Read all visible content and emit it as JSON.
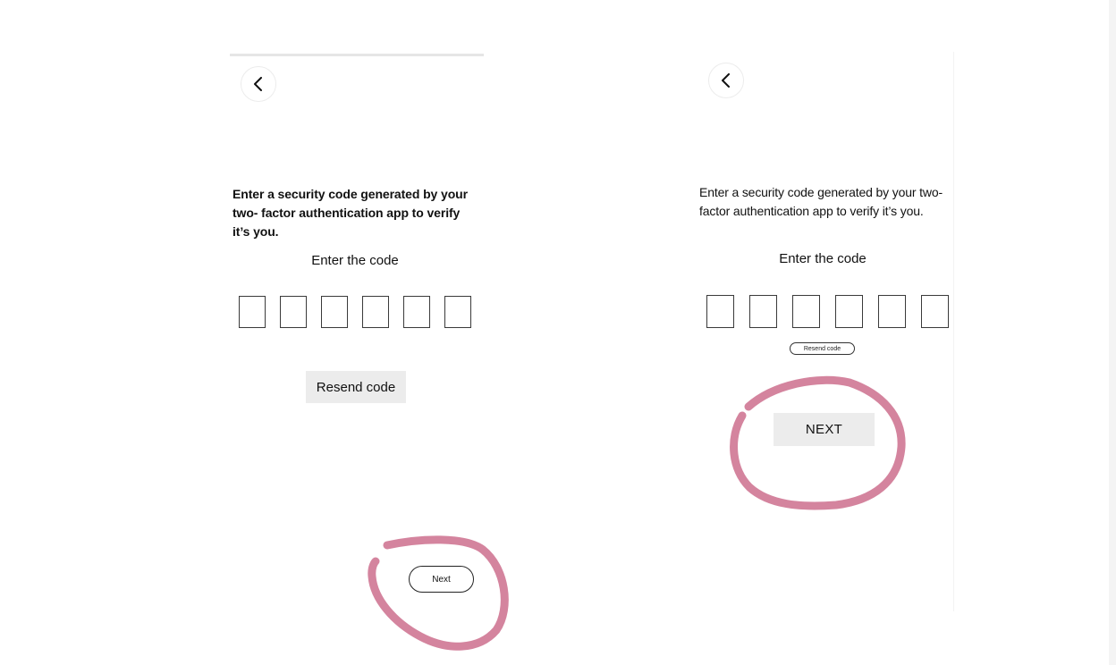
{
  "colors": {
    "annotation_stroke": "#d4849e",
    "button_fill": "#ececec",
    "text": "#111111"
  },
  "screens": [
    {
      "back_icon": "chevron-left-icon",
      "instructions": "Enter a security code generated by your two- factor authentication app to verify it’s you.",
      "code_label": "Enter the code",
      "code_digits": 6,
      "resend_label": "Resend code",
      "next_label": "Next"
    },
    {
      "back_icon": "chevron-left-icon",
      "instructions": "Enter a security code generated by your two- factor authentication app to verify it’s you.",
      "code_label": "Enter the code",
      "code_digits": 6,
      "resend_label": "Resend code",
      "next_label": "NEXT"
    }
  ]
}
